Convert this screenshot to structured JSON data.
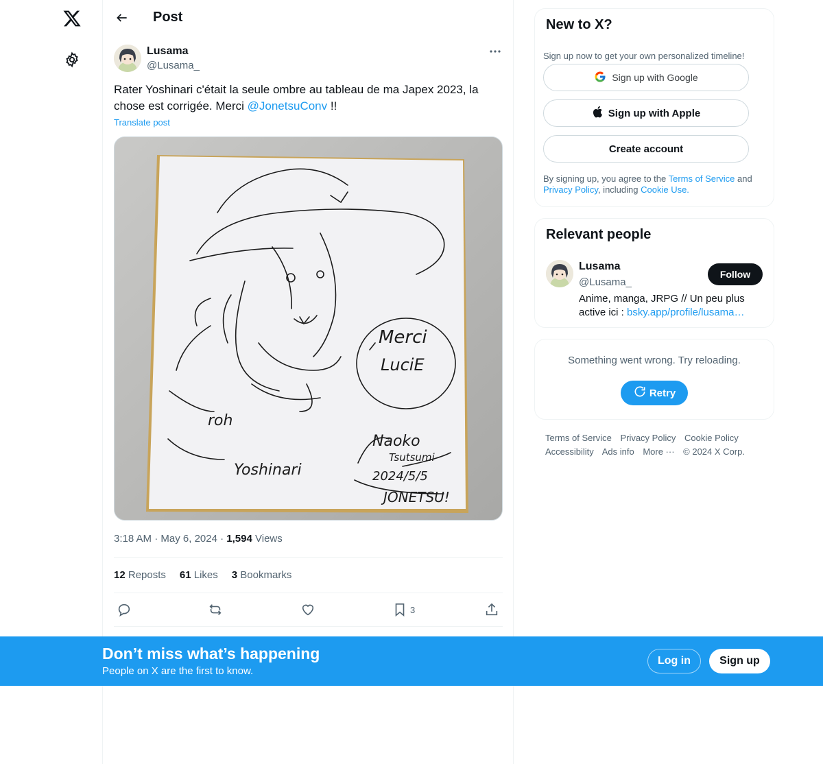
{
  "header": {
    "title": "Post"
  },
  "post": {
    "author_name": "Lusama",
    "author_handle": "@Lusama_",
    "text_before": "Rater Yoshinari c'était la seule ombre au tableau de ma Japex 2023, la chose est corrigée. Merci ",
    "mention": "@JonetsuConv",
    "text_after": " !!",
    "translate": "Translate post",
    "image_texts": [
      "Merci",
      "LuciE",
      "Naoko",
      "Tsutsumi",
      "2024/5/5",
      "JONETSU!",
      "roh",
      "Yoshinari"
    ],
    "time": "3:18 AM",
    "date": "May 6, 2024",
    "views_count": "1,594",
    "views_label": "Views",
    "reposts_count": "12",
    "reposts_label": "Reposts",
    "likes_count": "61",
    "likes_label": "Likes",
    "bookmarks_count": "3",
    "bookmarks_label": "Bookmarks",
    "bookmark_action_count": "3"
  },
  "signup_card": {
    "title": "New to X?",
    "subtitle": "Sign up now to get your own personalized timeline!",
    "google": "Sign up with Google",
    "apple": "Sign up with Apple",
    "create": "Create account",
    "legal_1": "By signing up, you agree to the ",
    "terms": "Terms of Service",
    "legal_2": " and ",
    "privacy": "Privacy Policy",
    "legal_3": ", including ",
    "cookie": "Cookie Use.",
    "legal_4": ""
  },
  "relevant": {
    "title": "Relevant people",
    "name": "Lusama",
    "handle": "@Lusama_",
    "follow": "Follow",
    "bio_text": "Anime, manga, JRPG // Un peu plus active ici : ",
    "bio_link": "bsky.app/profile/lusama…"
  },
  "error_card": {
    "message": "Something went wrong. Try reloading.",
    "retry": "Retry"
  },
  "footer": {
    "links": [
      "Terms of Service",
      "Privacy Policy",
      "Cookie Policy",
      "Accessibility",
      "Ads info",
      "More ···"
    ],
    "copyright": "© 2024 X Corp."
  },
  "bottom_bar": {
    "title": "Don’t miss what’s happening",
    "subtitle": "People on X are the first to know.",
    "login": "Log in",
    "signup": "Sign up"
  },
  "colors": {
    "accent": "#1d9bf0",
    "text": "#0f1419",
    "muted": "#536471",
    "border": "#eff3f4"
  }
}
